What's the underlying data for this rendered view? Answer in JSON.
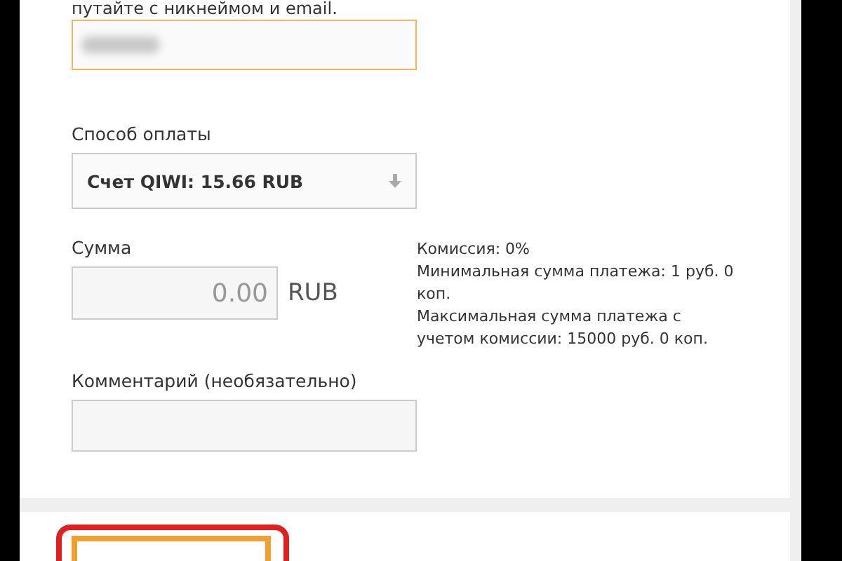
{
  "form": {
    "hint": "путайте с никнеймом и email.",
    "nickname": {
      "blurred": true
    },
    "payment": {
      "label": "Способ оплаты",
      "value": "Счет QIWI: 15.66 RUB"
    },
    "amount": {
      "label": "Сумма",
      "placeholder": "0.00",
      "currency": "RUB"
    },
    "info": [
      "Комиссия: 0%",
      "Минимальная сумма платежа: 1 руб. 0 коп.",
      "Максимальная сумма платежа с учетом комиссии: 15000 руб. 0 коп."
    ],
    "comment": {
      "label": "Комментарий (необязательно)"
    }
  },
  "footer": {
    "button": {
      "highlighted": true
    }
  }
}
